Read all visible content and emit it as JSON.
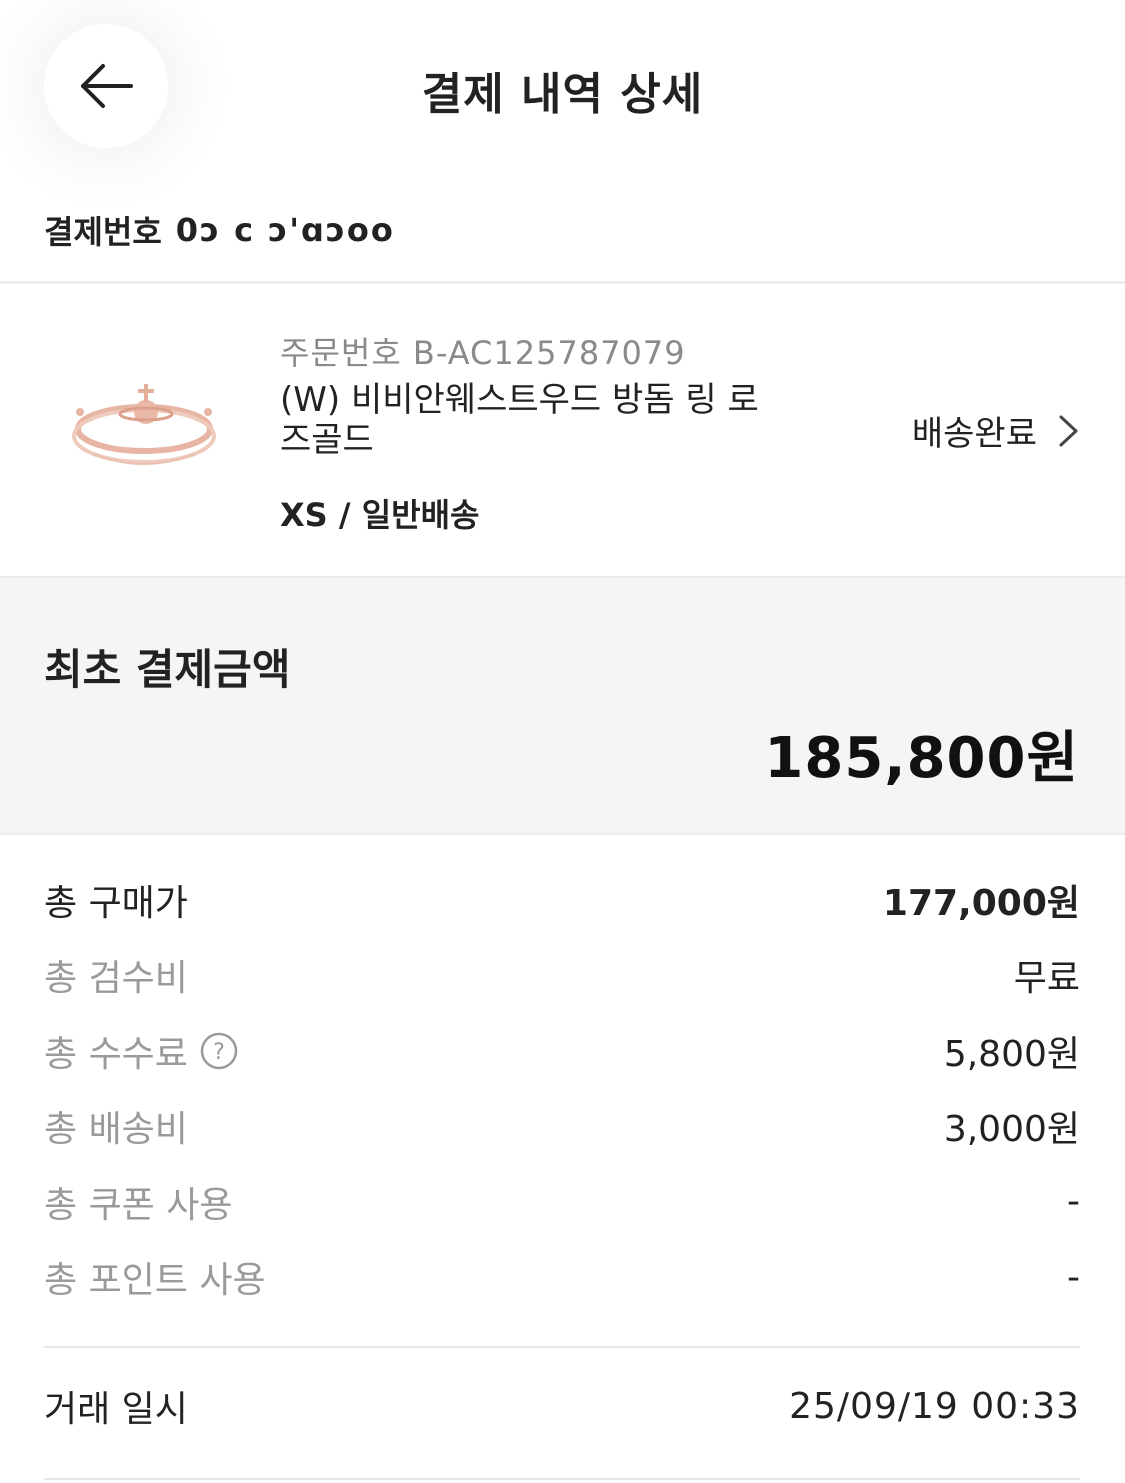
{
  "header": {
    "title": "결제 내역 상세"
  },
  "payment": {
    "label": "결제번호",
    "value": "0ɔ  c      ɔ'ɑɔoo"
  },
  "order": {
    "order_no": "주문번호 B-AC125787079",
    "product_name": "(W) 비비안웨스트우드 방돔 링 로즈골드",
    "option": "XS / 일반배송",
    "status": "배송완료",
    "image_icon": "ring-product-image"
  },
  "initial_payment": {
    "label": "최초 결제금액",
    "amount": "185,800원"
  },
  "breakdown": [
    {
      "label": "총 구매가",
      "value": "177,000원",
      "emphasis": true,
      "help": false
    },
    {
      "label": "총 검수비",
      "value": "무료",
      "emphasis": false,
      "help": false
    },
    {
      "label": "총 수수료",
      "value": "5,800원",
      "emphasis": false,
      "help": true
    },
    {
      "label": "총 배송비",
      "value": "3,000원",
      "emphasis": false,
      "help": false
    },
    {
      "label": "총 쿠폰 사용",
      "value": "-",
      "emphasis": false,
      "help": false
    },
    {
      "label": "총 포인트 사용",
      "value": "-",
      "emphasis": false,
      "help": false
    }
  ],
  "transaction": {
    "label": "거래 일시",
    "value": "25/09/19 00:33"
  },
  "colors": {
    "text": "#222222",
    "muted": "#9a9a9a",
    "panel": "#f5f5f5",
    "product_gold": "#e8b4a4"
  }
}
